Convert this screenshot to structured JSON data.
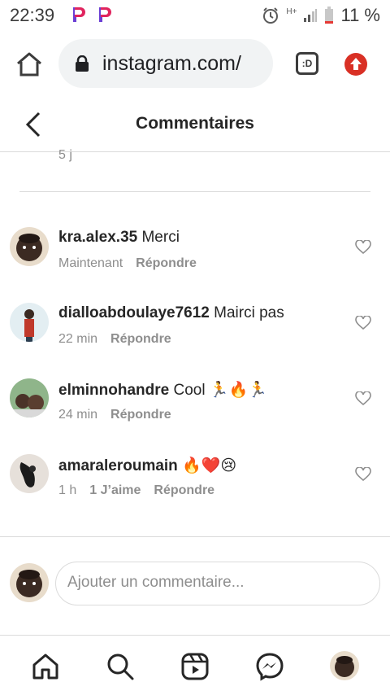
{
  "status_bar": {
    "time": "22:39",
    "battery": "11 %",
    "network_label": "H+"
  },
  "browser": {
    "url": "instagram.com/",
    "tabs_label": ":D"
  },
  "header": {
    "title": "Commentaires"
  },
  "previous_comment_meta": "5 j",
  "comments": [
    {
      "username": "kra.alex.35",
      "text": "Merci",
      "time": "Maintenant",
      "likes": "",
      "reply": "Répondre"
    },
    {
      "username": "dialloabdoulaye7612",
      "text": "Mairci pas",
      "time": "22 min",
      "likes": "",
      "reply": "Répondre"
    },
    {
      "username": "elminnohandre",
      "text": "Cool 🏃🔥🏃",
      "time": "24 min",
      "likes": "",
      "reply": "Répondre"
    },
    {
      "username": "amaraleroumain",
      "text": "🔥❤️😢",
      "time": "1 h",
      "likes": "1 J’aime",
      "reply": "Répondre"
    }
  ],
  "add_comment": {
    "placeholder": "Ajouter un commentaire..."
  },
  "colors": {
    "update_button": "#d93025",
    "text_secondary": "#8e8e8e",
    "divider": "#dbdbdb"
  },
  "icons": [
    "home-icon",
    "lock-icon",
    "tabs-icon",
    "update-icon",
    "back-icon",
    "heart-icon",
    "search-icon",
    "reels-icon",
    "messenger-icon"
  ]
}
